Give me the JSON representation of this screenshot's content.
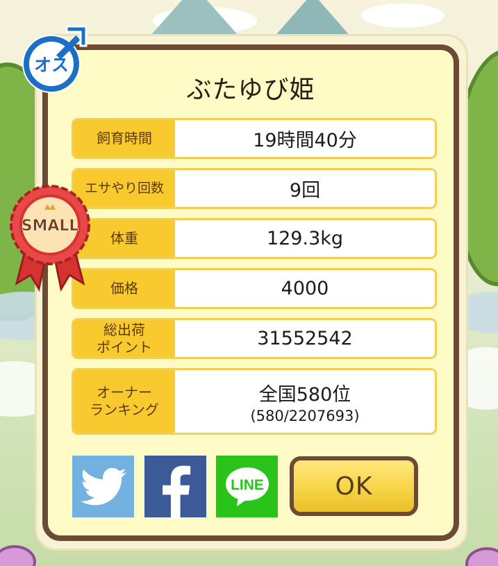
{
  "dialog": {
    "title": "ぶたゆび姫",
    "rows": [
      {
        "label": "飼育時間",
        "value": "19時間40分"
      },
      {
        "label": "エサやり回数",
        "value": "9回"
      },
      {
        "label": "体重",
        "value": "129.3kg"
      },
      {
        "label": "価格",
        "value": "4000"
      },
      {
        "label": "総出荷\nポイント",
        "value": "31552542"
      },
      {
        "label": "オーナー\nランキング",
        "value": "全国580位",
        "sub": "(580/2207693)"
      }
    ]
  },
  "badges": {
    "gender": "オス",
    "size": "SMALL"
  },
  "share": {
    "twitter_icon": "twitter-bird-icon",
    "facebook_icon": "facebook-f-icon",
    "line_label": "LINE"
  },
  "ok_label": "OK",
  "colors": {
    "dialog_border": "#6b4b34",
    "dialog_bg": "#fffbc6",
    "label_bg": "#f9ca2e",
    "row_border": "#f1cf55",
    "twitter": "#73b1e0",
    "facebook": "#3c5a98",
    "line": "#2ac31a",
    "male_blue": "#1b6fc4",
    "ribbon_red": "#e03a3a"
  }
}
